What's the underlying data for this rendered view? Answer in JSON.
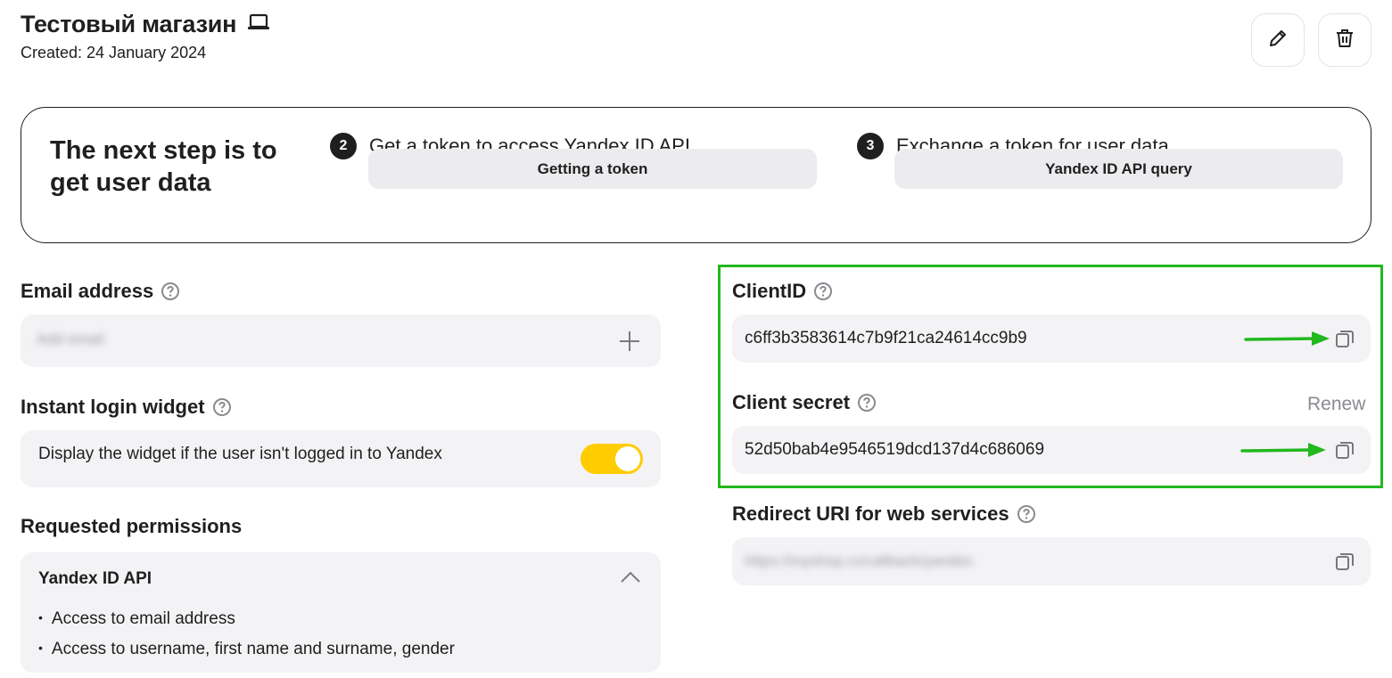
{
  "header": {
    "title": "Тестовый магазин",
    "created": "Created: 24 January 2024"
  },
  "steps": {
    "heading": "The next step is to get user data",
    "step2": {
      "number": "2",
      "title": "Get a token to access Yandex ID API",
      "button": "Getting a token"
    },
    "step3": {
      "number": "3",
      "title": "Exchange a token for user data",
      "button": "Yandex ID API query"
    }
  },
  "email": {
    "label": "Email address",
    "placeholder": "Add email"
  },
  "widget": {
    "label": "Instant login widget",
    "text": "Display the widget if the user isn't logged in to Yandex",
    "enabled": true
  },
  "permissions": {
    "label": "Requested permissions",
    "group_title": "Yandex ID API",
    "items": [
      "Access to email address",
      "Access to username, first name and surname, gender"
    ]
  },
  "client_id": {
    "label": "ClientID",
    "value": "c6ff3b3583614c7b9f21ca24614cc9b9"
  },
  "client_secret": {
    "label": "Client secret",
    "renew": "Renew",
    "value": "52d50bab4e9546519dcd137d4c686069"
  },
  "redirect": {
    "label": "Redirect URI for web services",
    "value": "https://myshop.ru/callback/yandex"
  },
  "colors": {
    "highlight": "#22b81e",
    "arrow": "#22b81e",
    "toggle_on": "#ffcc00",
    "field_bg": "#f3f3f5"
  },
  "icons": [
    "laptop-icon",
    "pencil-icon",
    "trash-icon",
    "help-icon",
    "plus-icon",
    "chevron-up-icon",
    "copy-icon",
    "arrow-icon"
  ]
}
